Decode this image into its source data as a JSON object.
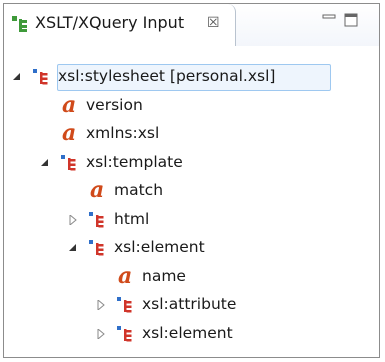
{
  "view": {
    "tab_title": "XSLT/XQuery Input",
    "close_glyph": "☒"
  },
  "tree": [
    {
      "label": "xsl:stylesheet [personal.xsl]",
      "type": "element",
      "depth": 0,
      "twisty": "expanded"
    },
    {
      "label": "version",
      "type": "attribute",
      "depth": 1,
      "twisty": "none"
    },
    {
      "label": "xmlns:xsl",
      "type": "attribute",
      "depth": 1,
      "twisty": "none"
    },
    {
      "label": "xsl:template",
      "type": "element",
      "depth": 1,
      "twisty": "expanded"
    },
    {
      "label": "match",
      "type": "attribute",
      "depth": 2,
      "twisty": "none"
    },
    {
      "label": "html",
      "type": "element",
      "depth": 2,
      "twisty": "collapsed"
    },
    {
      "label": "xsl:element",
      "type": "element",
      "depth": 2,
      "twisty": "expanded"
    },
    {
      "label": "name",
      "type": "attribute",
      "depth": 3,
      "twisty": "none"
    },
    {
      "label": "xsl:attribute",
      "type": "element",
      "depth": 3,
      "twisty": "collapsed"
    },
    {
      "label": "xsl:element",
      "type": "element",
      "depth": 3,
      "twisty": "collapsed"
    }
  ],
  "icons": {
    "element": "xml-element-icon",
    "attribute": "xml-attribute-icon",
    "attribute_glyph": "a"
  },
  "colors": {
    "selection_border": "#9ec8f0",
    "attribute_icon": "#d04a1a",
    "element_icon_blue": "#2f6fc9",
    "element_icon_red": "#d0352a",
    "element_icon_green": "#3f9a3a"
  }
}
